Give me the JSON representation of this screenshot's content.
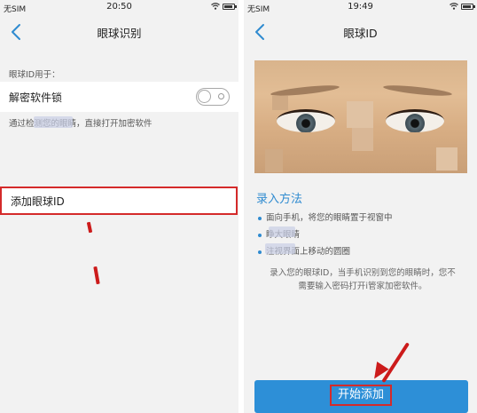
{
  "left": {
    "status": {
      "carrier": "无SIM",
      "time": "20:50"
    },
    "nav": {
      "title": "眼球识别"
    },
    "section_label": "眼球ID用于：",
    "unlock": {
      "label": "解密软件锁",
      "description": "通过检测您的眼睛，直接打开加密软件",
      "toggle_on": false
    },
    "add_item": {
      "label": "添加眼球ID"
    }
  },
  "right": {
    "status": {
      "carrier": "无SIM",
      "time": "19:49"
    },
    "nav": {
      "title": "眼球ID"
    },
    "method": {
      "title": "录入方法",
      "bullets": [
        "面向手机，将您的眼睛置于视窗中",
        "睁大眼睛",
        "注视界面上移动的圆圈"
      ]
    },
    "note_lines": [
      "录入您的眼球ID，当手机识别到您的眼睛时，您不",
      "需要输入密码打开i管家加密软件。"
    ],
    "start_button": {
      "label": "开始添加"
    }
  },
  "colors": {
    "accent_blue": "#2d8fd7",
    "highlight_red": "#d42a2a"
  }
}
